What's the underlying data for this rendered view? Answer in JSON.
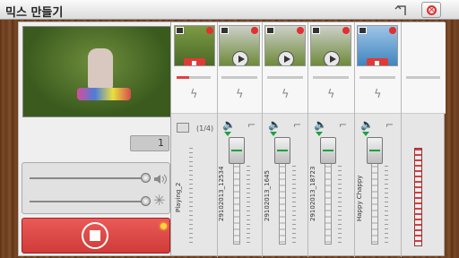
{
  "app": {
    "title": "믹스 만들기"
  },
  "toolbar": {
    "back_icon": "back-arrow-icon",
    "close_icon": "close-icon"
  },
  "preview": {
    "counter": "1"
  },
  "controls": {
    "volume_slider_value": 1.0,
    "effect_slider_value": 1.0,
    "volume_icon": "speaker-icon",
    "effect_icon": "star-icon",
    "record_icon": "stop-icon"
  },
  "image_track": {
    "count_label": "(1/4)",
    "clip_label": "playing_2"
  },
  "tracks": [
    {
      "type": "photo",
      "label": "Playing_2",
      "icon": "image-icon"
    },
    {
      "type": "video",
      "label": "29102013_12534",
      "icon": "film-icon"
    },
    {
      "type": "video",
      "label": "29102013_1645",
      "icon": "film-icon"
    },
    {
      "type": "video",
      "label": "29102013_18723",
      "icon": "film-icon"
    },
    {
      "type": "audio",
      "label": "Happy Chappy",
      "icon": "music-note-icon"
    }
  ],
  "colors": {
    "accent_red": "#e13a36",
    "active_green": "#1fa040",
    "wood": "#6b3e1e"
  }
}
